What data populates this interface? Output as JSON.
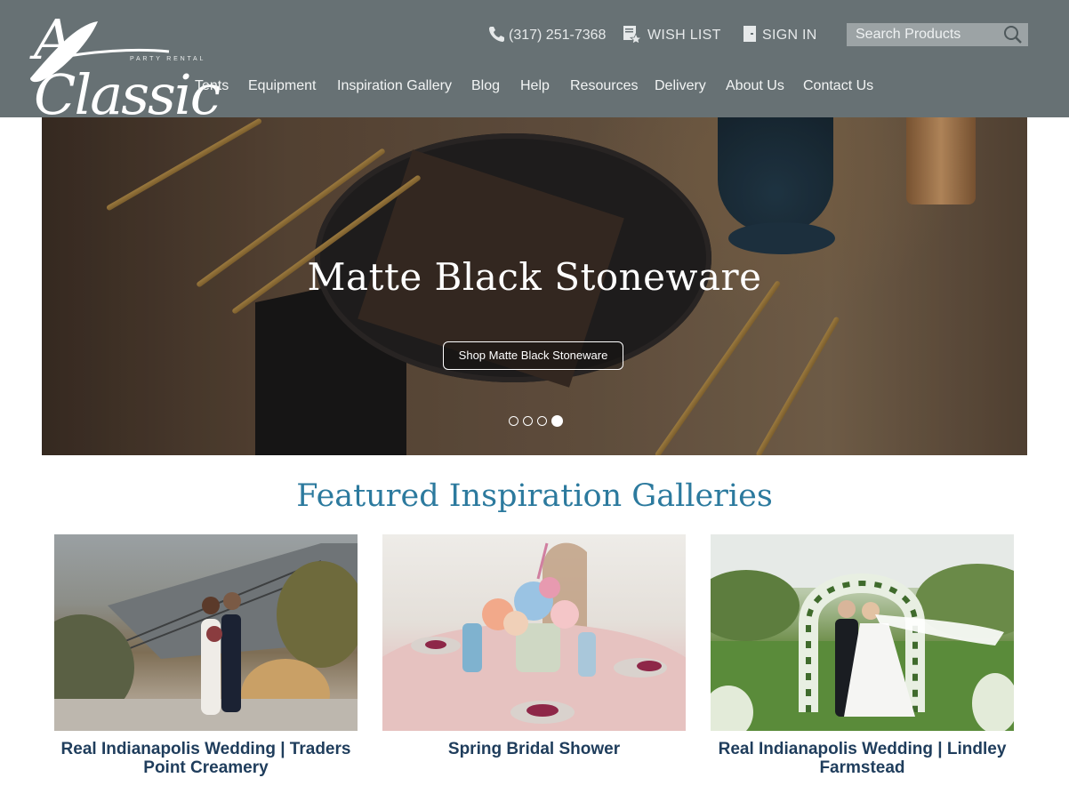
{
  "brand": {
    "name": "A Classic",
    "tagline": "PARTY RENTAL"
  },
  "utility": {
    "phone": "(317) 251-7368",
    "wish_list": "WISH LIST",
    "sign_in": "SIGN IN"
  },
  "search": {
    "placeholder": "Search Products"
  },
  "nav": {
    "items": [
      {
        "label": "Tents"
      },
      {
        "label": "Equipment"
      },
      {
        "label": "Inspiration Gallery"
      },
      {
        "label": "Blog"
      },
      {
        "label": "Help"
      },
      {
        "label": "Resources"
      },
      {
        "label": "Delivery"
      },
      {
        "label": "About Us"
      },
      {
        "label": "Contact Us"
      }
    ]
  },
  "hero": {
    "title": "Matte Black Stoneware",
    "button": "Shop Matte Black Stoneware",
    "slide_count": 4,
    "active_slide": 4
  },
  "featured": {
    "title": "Featured Inspiration Galleries",
    "cards": [
      {
        "caption": "Real Indianapolis Wedding | Traders Point Creamery"
      },
      {
        "caption": "Spring Bridal Shower"
      },
      {
        "caption": "Real Indianapolis Wedding | Lindley Farmstead"
      }
    ]
  },
  "colors": {
    "header_bg": "#677174",
    "accent_title": "#2c7a9e",
    "caption": "#1f3d5c"
  }
}
